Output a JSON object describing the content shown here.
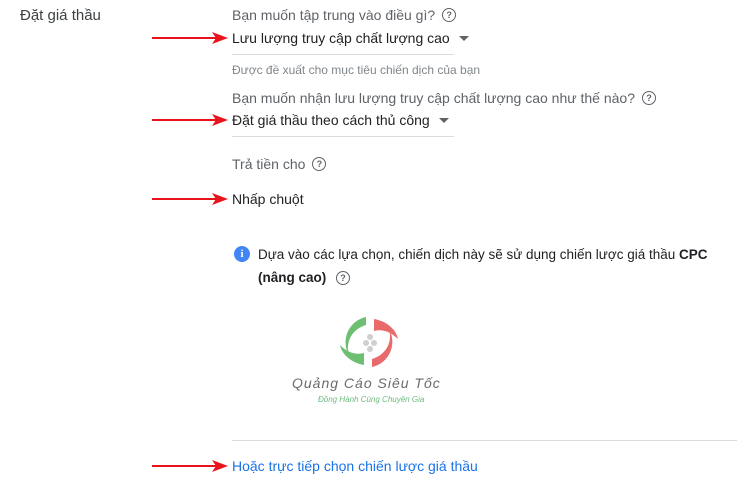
{
  "section": {
    "label": "Đặt giá thầu"
  },
  "focus": {
    "question": "Bạn muốn tập trung vào điều gì?",
    "selected": "Lưu lượng truy cập chất lượng cao",
    "hint": "Được đề xuất cho mục tiêu chiến dịch của bạn"
  },
  "method": {
    "question": "Bạn muốn nhận lưu lượng truy cập chất lượng cao như thế nào?",
    "selected": "Đặt giá thầu theo cách thủ công"
  },
  "payment": {
    "question": "Trả tiền cho",
    "value": "Nhấp chuột"
  },
  "info": {
    "text_prefix": "Dựa vào các lựa chọn, chiến dịch này sẽ sử dụng chiến lược giá thầu ",
    "text_bold": "CPC",
    "text_bold2": "(nâng cao)"
  },
  "watermark": {
    "title": "Quảng Cáo Siêu Tốc",
    "subtitle": "Đồng Hành Cùng Chuyên Gia"
  },
  "link": {
    "label": "Hoặc trực tiếp chọn chiến lược giá thầu"
  },
  "colors": {
    "arrow": "#e8131b",
    "link": "#1a73e8",
    "info": "#4285f4"
  },
  "icons": {
    "help": "help-circle-icon",
    "info": "info-icon",
    "dropdown": "caret-down-icon",
    "annotation": "red-arrow-icon"
  }
}
